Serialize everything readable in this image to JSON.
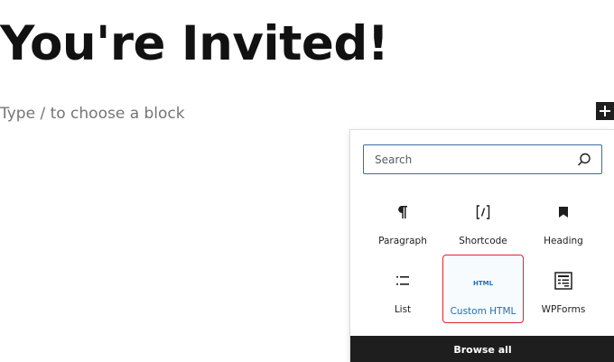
{
  "page": {
    "title": "You're Invited!",
    "placeholder": "Type / to choose a block"
  },
  "inserter": {
    "search_placeholder": "Search",
    "blocks": [
      {
        "label": "Paragraph",
        "icon": "paragraph-icon"
      },
      {
        "label": "Shortcode",
        "icon": "shortcode-icon"
      },
      {
        "label": "Heading",
        "icon": "heading-icon"
      },
      {
        "label": "List",
        "icon": "list-icon"
      },
      {
        "label": "Custom HTML",
        "icon": "html-icon",
        "icon_text": "HTML",
        "selected": true
      },
      {
        "label": "WPForms",
        "icon": "wpforms-icon"
      }
    ],
    "browse_all_label": "Browse all"
  },
  "colors": {
    "highlight_border": "#e0242d",
    "accent": "#2271b1",
    "dark": "#1e1e1e"
  }
}
